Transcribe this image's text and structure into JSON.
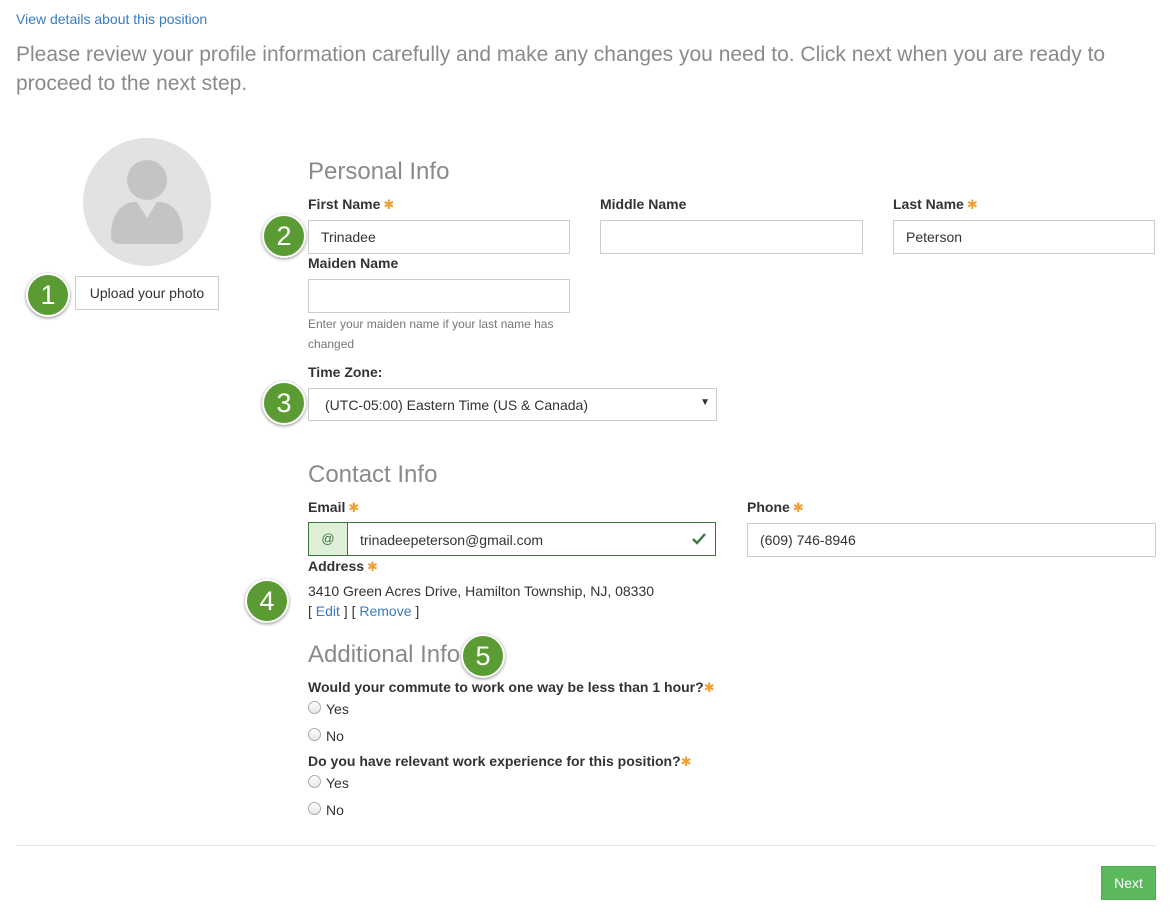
{
  "top_link": "View details about this position",
  "intro": "Please review your profile information carefully and make any changes you need to. Click next when you are ready to proceed to the next step.",
  "photo": {
    "upload_label": "Upload your photo"
  },
  "badges": [
    "1",
    "2",
    "3",
    "4",
    "5"
  ],
  "required_mark": "✱",
  "personal": {
    "title": "Personal Info",
    "first_name": {
      "label": "First Name",
      "value": "Trinadee"
    },
    "middle_name": {
      "label": "Middle Name",
      "value": ""
    },
    "last_name": {
      "label": "Last Name",
      "value": "Peterson"
    },
    "maiden_name": {
      "label": "Maiden Name",
      "value": "",
      "help": "Enter your maiden name if your last name has changed"
    },
    "time_zone": {
      "label": "Time Zone:",
      "value": "(UTC-05:00) Eastern Time (US & Canada)"
    }
  },
  "contact": {
    "title": "Contact Info",
    "email": {
      "label": "Email",
      "prefix": "@",
      "value": "trinadeepeterson@gmail.com"
    },
    "phone": {
      "label": "Phone",
      "value": "(609) 746-8946"
    },
    "address": {
      "label": "Address",
      "value": "3410 Green Acres Drive, Hamilton Township, NJ, 08330",
      "edit": "Edit",
      "remove": "Remove"
    }
  },
  "additional": {
    "title": "Additional Info",
    "questions": [
      {
        "text": "Would your commute to work one way be less than 1 hour?",
        "options": [
          "Yes",
          "No"
        ]
      },
      {
        "text": "Do you have relevant work experience for this position?",
        "options": [
          "Yes",
          "No"
        ]
      }
    ]
  },
  "next_label": "Next",
  "colors": {
    "accent_green": "#5cb85c",
    "badge_green": "#5a9b33",
    "link_blue": "#3a7bbf",
    "required_orange": "#f0a030"
  }
}
